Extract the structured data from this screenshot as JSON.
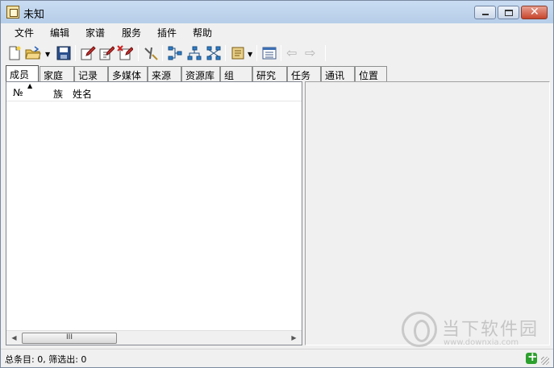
{
  "window": {
    "title": "未知",
    "minimize_icon": "minimize-icon",
    "maximize_icon": "maximize-icon",
    "close_icon": "close-icon",
    "close_glyph": "✕"
  },
  "menubar": {
    "items": [
      {
        "label": "文件"
      },
      {
        "label": "编辑"
      },
      {
        "label": "家谱"
      },
      {
        "label": "服务"
      },
      {
        "label": "插件"
      },
      {
        "label": "帮助"
      }
    ]
  },
  "toolbar": {
    "icons": [
      "new-file-icon",
      "open-folder-icon",
      "save-icon",
      "edit-record-icon",
      "edit-record-pin-icon",
      "delete-record-icon",
      "tools-icon",
      "pedigree-tree-icon",
      "descendant-tree-icon",
      "family-tree-icon",
      "scroll-book-icon",
      "list-view-icon",
      "back-arrow-icon",
      "forward-arrow-icon"
    ],
    "dropdown_glyph": "▼",
    "back_glyph": "⇦",
    "forward_glyph": "⇨"
  },
  "tabs": [
    {
      "label": "成员",
      "active": true
    },
    {
      "label": "家庭"
    },
    {
      "label": "记录"
    },
    {
      "label": "多媒体"
    },
    {
      "label": "来源"
    },
    {
      "label": "资源库"
    },
    {
      "label": "组"
    },
    {
      "label": "研究"
    },
    {
      "label": "任务"
    },
    {
      "label": "通讯"
    },
    {
      "label": "位置"
    }
  ],
  "list": {
    "columns": [
      "№",
      "族",
      "姓名"
    ],
    "sort_glyph": "▲",
    "rows": []
  },
  "scrollbar": {
    "left_glyph": "◀",
    "right_glyph": "▶",
    "thumb_glyph": "III"
  },
  "status": {
    "text": "总条目: 0, 筛选出: 0"
  },
  "watermark": {
    "title": "当下软件园",
    "url": "www.downxia.com"
  },
  "colors": {
    "titlebar": "#b9cfe9",
    "close_button": "#c7442c",
    "status_icon": "#2ca02c"
  }
}
